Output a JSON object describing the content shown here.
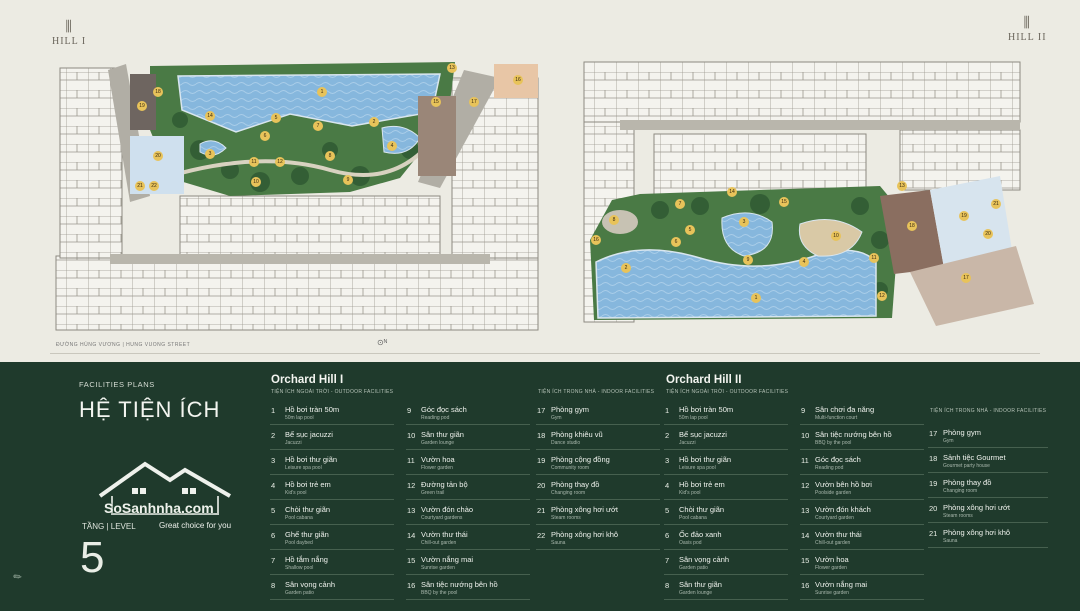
{
  "logos": {
    "left": "HILL I",
    "right": "HILL II"
  },
  "street": "ĐƯỜNG HÙNG VƯƠNG | HUNG VUONG STREET",
  "legend": {
    "facilities_label": "FACILITIES PLANS",
    "title": "HỆ TIỆN ÍCH",
    "level_label": "TẦNG | LEVEL",
    "level_number": "5",
    "watermark": {
      "brand": "SoSanhnha.com",
      "tagline": "Great choice for you"
    },
    "hill1": {
      "name": "Orchard Hill I",
      "outdoor_label": "TIỆN ÍCH NGOÀI TRỜI - OUTDOOR FACILITIES",
      "indoor_label": "TIỆN ÍCH TRONG NHÀ - INDOOR FACILITIES",
      "col1": [
        {
          "n": "1",
          "vi": "Hồ bơi tràn 50m",
          "en": "50m lap pool"
        },
        {
          "n": "2",
          "vi": "Bể sục jacuzzi",
          "en": "Jacuzzi"
        },
        {
          "n": "3",
          "vi": "Hồ bơi thư giãn",
          "en": "Leisure spa pool"
        },
        {
          "n": "4",
          "vi": "Hồ bơi trẻ em",
          "en": "Kid's pool"
        },
        {
          "n": "5",
          "vi": "Chòi thư giãn",
          "en": "Pool cabana"
        },
        {
          "n": "6",
          "vi": "Ghế thư giãn",
          "en": "Pool daybed"
        },
        {
          "n": "7",
          "vi": "Hồ tắm nắng",
          "en": "Shallow pool"
        },
        {
          "n": "8",
          "vi": "Sân vọng cảnh",
          "en": "Garden patio"
        }
      ],
      "col2": [
        {
          "n": "9",
          "vi": "Góc đọc sách",
          "en": "Reading pod"
        },
        {
          "n": "10",
          "vi": "Sân thư giãn",
          "en": "Garden lounge"
        },
        {
          "n": "11",
          "vi": "Vườn hoa",
          "en": "Flower garden"
        },
        {
          "n": "12",
          "vi": "Đường tản bộ",
          "en": "Green trail"
        },
        {
          "n": "13",
          "vi": "Vườn đón chào",
          "en": "Courtyard gardens"
        },
        {
          "n": "14",
          "vi": "Vườn thư thái",
          "en": "Chill-out garden"
        },
        {
          "n": "15",
          "vi": "Vườn nắng mai",
          "en": "Sunrise garden"
        },
        {
          "n": "16",
          "vi": "Sân tiệc nướng bên hồ",
          "en": "BBQ by the pool"
        }
      ],
      "col3": [
        {
          "n": "17",
          "vi": "Phòng gym",
          "en": "Gym"
        },
        {
          "n": "18",
          "vi": "Phòng khiêu vũ",
          "en": "Dance studio"
        },
        {
          "n": "19",
          "vi": "Phòng cộng đồng",
          "en": "Community room"
        },
        {
          "n": "20",
          "vi": "Phòng thay đồ",
          "en": "Changing room"
        },
        {
          "n": "21",
          "vi": "Phòng xông hơi ướt",
          "en": "Steam rooms"
        },
        {
          "n": "22",
          "vi": "Phòng xông hơi khô",
          "en": "Sauna"
        }
      ]
    },
    "hill2": {
      "name": "Orchard Hill II",
      "outdoor_label": "TIỆN ÍCH NGOÀI TRỜI - OUTDOOR FACILITIES",
      "indoor_label": "TIỆN ÍCH TRONG NHÀ - INDOOR FACILITIES",
      "col1": [
        {
          "n": "1",
          "vi": "Hồ bơi tràn 50m",
          "en": "50m lap pool"
        },
        {
          "n": "2",
          "vi": "Bể sục jacuzzi",
          "en": "Jacuzzi"
        },
        {
          "n": "3",
          "vi": "Hồ bơi thư giãn",
          "en": "Leisure spa pool"
        },
        {
          "n": "4",
          "vi": "Hồ bơi trẻ em",
          "en": "Kid's pool"
        },
        {
          "n": "5",
          "vi": "Chòi thư giãn",
          "en": "Pool cabana"
        },
        {
          "n": "6",
          "vi": "Ốc đảo xanh",
          "en": "Oasis pod"
        },
        {
          "n": "7",
          "vi": "Sân vọng cảnh",
          "en": "Garden patio"
        },
        {
          "n": "8",
          "vi": "Sân thư giãn",
          "en": "Garden lounge"
        }
      ],
      "col2": [
        {
          "n": "9",
          "vi": "Sân chơi đa năng",
          "en": "Multi-function court"
        },
        {
          "n": "10",
          "vi": "Sân tiệc nướng bên hồ",
          "en": "BBQ by the pool"
        },
        {
          "n": "11",
          "vi": "Góc đọc sách",
          "en": "Reading pod"
        },
        {
          "n": "12",
          "vi": "Vườn bên hồ bơi",
          "en": "Poolside garden"
        },
        {
          "n": "13",
          "vi": "Vườn đón khách",
          "en": "Courtyard garden"
        },
        {
          "n": "14",
          "vi": "Vườn thư thái",
          "en": "Chill-out garden"
        },
        {
          "n": "15",
          "vi": "Vườn hoa",
          "en": "Flower garden"
        },
        {
          "n": "16",
          "vi": "Vườn nắng mai",
          "en": "Sunrise garden"
        }
      ],
      "col3": [
        {
          "n": "17",
          "vi": "Phòng gym",
          "en": "Gym"
        },
        {
          "n": "18",
          "vi": "Sảnh tiệc Gourmet",
          "en": "Gourmet party house"
        },
        {
          "n": "19",
          "vi": "Phòng thay đồ",
          "en": "Changing room"
        },
        {
          "n": "20",
          "vi": "Phòng xông hơi ướt",
          "en": "Steam rooms"
        },
        {
          "n": "21",
          "vi": "Phòng xông hơi khô",
          "en": "Sauna"
        }
      ]
    }
  },
  "plan1_markers": [
    "1",
    "2",
    "3",
    "4",
    "5",
    "6",
    "7",
    "8",
    "9",
    "10",
    "11",
    "12",
    "13",
    "14",
    "15",
    "16",
    "17",
    "18",
    "19",
    "20",
    "21",
    "22"
  ],
  "plan2_markers": [
    "1",
    "2",
    "3",
    "4",
    "5",
    "6",
    "7",
    "8",
    "9",
    "10",
    "11",
    "12",
    "13",
    "14",
    "15",
    "16",
    "17",
    "18",
    "19",
    "20",
    "21"
  ],
  "colors": {
    "background": "#ecebe3",
    "legend_bg": "#1f3a2c",
    "pool": "#7fb0d8",
    "garden": "#3e6b3f",
    "badge": "#e8c35a",
    "amenity_block": "#8a6e60"
  }
}
